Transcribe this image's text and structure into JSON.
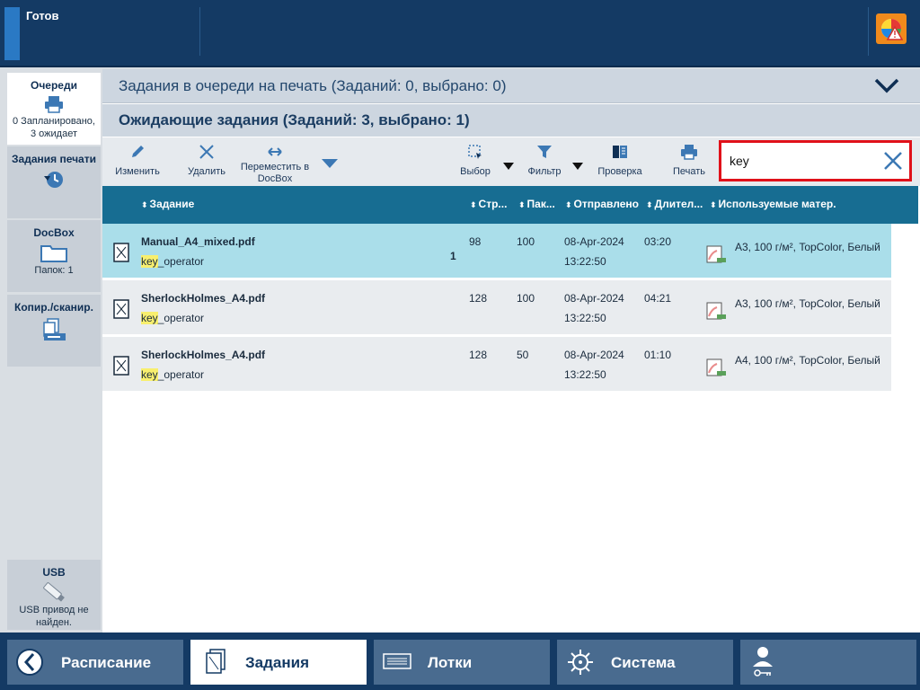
{
  "topbar": {
    "status": "Готов"
  },
  "sidebar": {
    "items": [
      {
        "title": "Очереди",
        "sub": [
          "0 Запланировано,",
          "3 ожидает"
        ]
      },
      {
        "title": "Задания печати",
        "sub": []
      },
      {
        "title": "DocBox",
        "sub": [
          "Папок: 1"
        ]
      },
      {
        "title": "Копир./сканир.",
        "sub": []
      },
      {
        "title": "USB",
        "sub": [
          "USB привод не",
          "найден."
        ]
      }
    ]
  },
  "main": {
    "queue_header": "Задания в очереди на печать (Заданий: 0, выбрано: 0)",
    "waiting_header": "Ожидающие задания (Заданий: 3, выбрано: 1)"
  },
  "toolbar": {
    "edit": "Изменить",
    "delete": "Удалить",
    "move_line1": "Переместить в",
    "move_line2": "DocBox",
    "select": "Выбор",
    "filter": "Фильтр",
    "proof": "Проверка",
    "print": "Печать"
  },
  "search": {
    "value": "key"
  },
  "table": {
    "columns": [
      "Задание",
      "Стр...",
      "Пак...",
      "Отправлено",
      "Длител...",
      "Используемые матер."
    ],
    "rows": [
      {
        "name": "Manual_A4_mixed.pdf",
        "owner_highlight": "key",
        "owner_rest": "_operator",
        "count": "1",
        "pages": "98",
        "sets": "100",
        "date": "08-Apr-2024",
        "time": "13:22:50",
        "duration": "03:20",
        "media": "A3, 100 г/м², TopColor, Белый"
      },
      {
        "name": "SherlockHolmes_A4.pdf",
        "owner_highlight": "key",
        "owner_rest": "_operator",
        "count": "",
        "pages": "128",
        "sets": "100",
        "date": "08-Apr-2024",
        "time": "13:22:50",
        "duration": "04:21",
        "media": "A3, 100 г/м², TopColor, Белый"
      },
      {
        "name": "SherlockHolmes_A4.pdf",
        "owner_highlight": "key",
        "owner_rest": "_operator",
        "count": "",
        "pages": "128",
        "sets": "50",
        "date": "08-Apr-2024",
        "time": "13:22:50",
        "duration": "01:10",
        "media": "A4, 100 г/м², TopColor, Белый"
      }
    ]
  },
  "bottom_nav": {
    "schedule": "Расписание",
    "jobs": "Задания",
    "trays": "Лотки",
    "system": "Система"
  },
  "colors": {
    "topbar": "#143a64",
    "table_header": "#176d92",
    "selected_row": "#aadeea",
    "search_border": "#e0111a",
    "highlight": "#f8ef6e"
  }
}
